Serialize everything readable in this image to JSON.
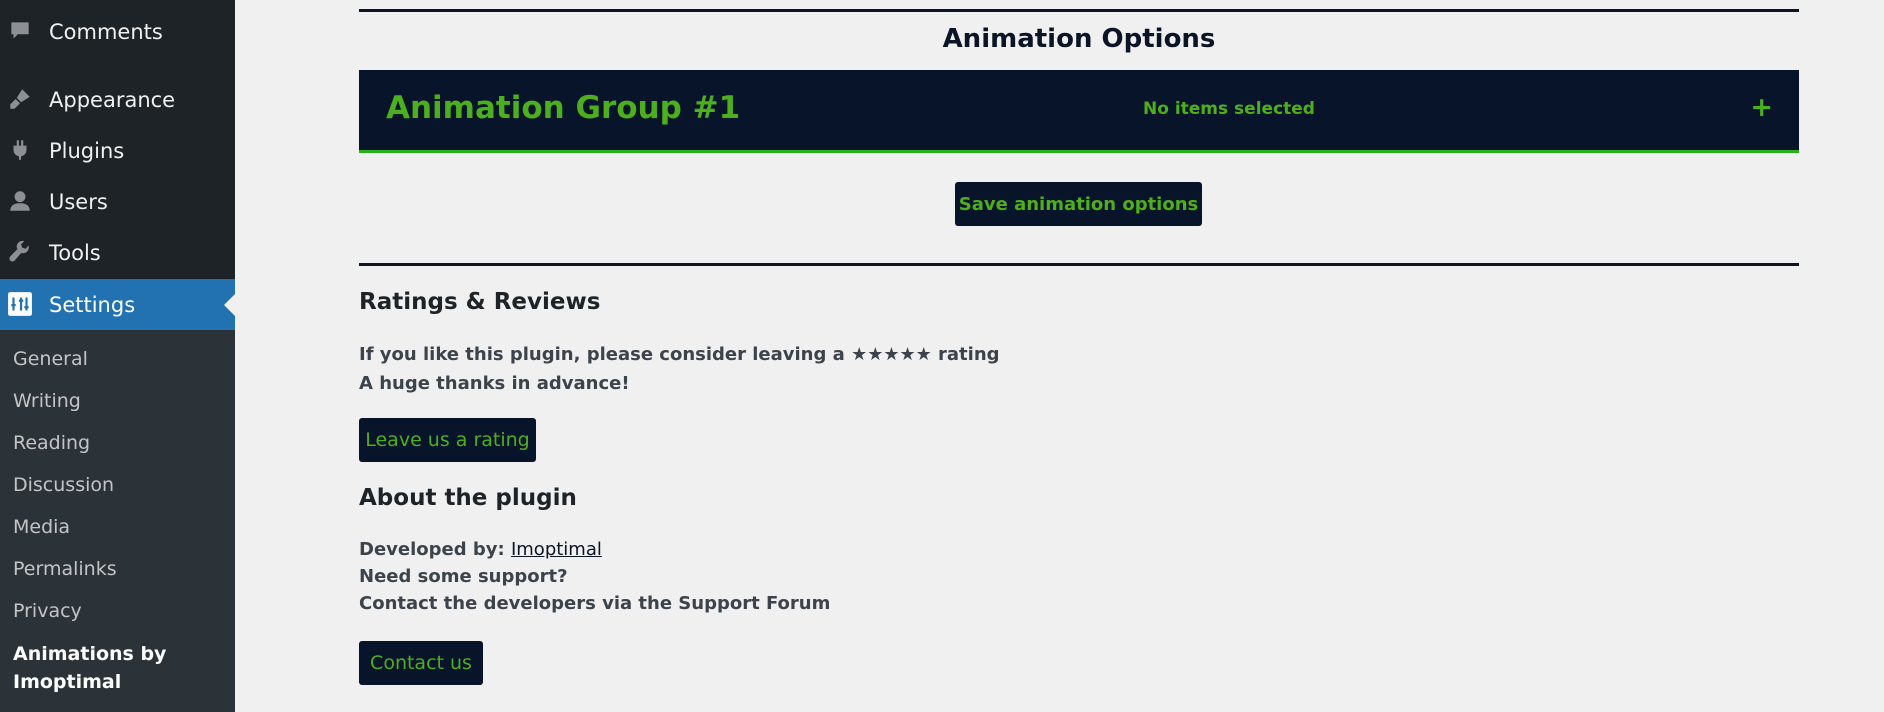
{
  "sidebar": {
    "items": [
      {
        "label": "Comments",
        "icon": "comment-icon"
      },
      {
        "label": "Appearance",
        "icon": "paintbrush-icon"
      },
      {
        "label": "Plugins",
        "icon": "plugin-icon"
      },
      {
        "label": "Users",
        "icon": "user-icon"
      },
      {
        "label": "Tools",
        "icon": "wrench-icon"
      },
      {
        "label": "Settings",
        "icon": "settings-icon",
        "active": true
      }
    ],
    "submenu": [
      "General",
      "Writing",
      "Reading",
      "Discussion",
      "Media",
      "Permalinks",
      "Privacy"
    ],
    "submenu_current": [
      "Animations by",
      "Imoptimal"
    ]
  },
  "main": {
    "animation_options_title": "Animation Options",
    "group": {
      "title": "Animation Group #1",
      "status": "No items selected",
      "toggle": "+"
    },
    "save_button": "Save animation options",
    "ratings": {
      "title": "Ratings & Reviews",
      "line1": "If you like this plugin, please consider leaving a ★★★★★ rating",
      "line2": "A huge thanks in advance!",
      "button": "Leave us a rating"
    },
    "about": {
      "title": "About the plugin",
      "developed_by": "Developed by:",
      "developer_link": "Imoptimal",
      "support_question": "Need some support?",
      "contact_text": "Contact the developers via the Support Forum",
      "button": "Contact us"
    }
  },
  "colors": {
    "sidebar_bg": "#1d2327",
    "active_bg": "#2271b1",
    "panel_dark": "#081429",
    "accent_green": "#4caf1e"
  }
}
